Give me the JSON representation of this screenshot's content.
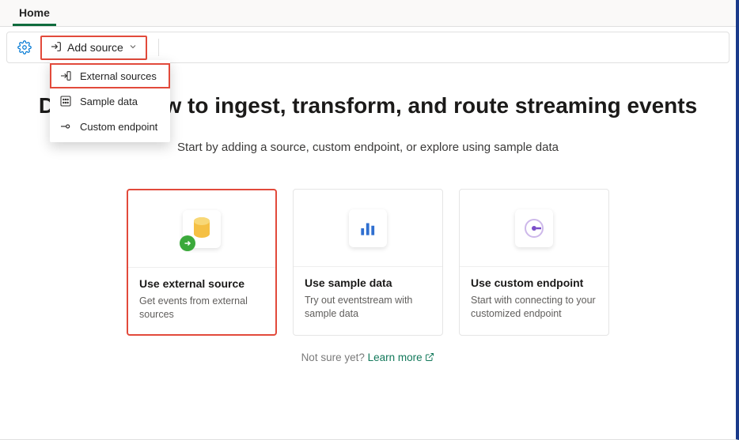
{
  "tabs": {
    "home": "Home"
  },
  "toolbar": {
    "add_source": "Add source"
  },
  "menu": {
    "external": "External sources",
    "sample": "Sample data",
    "custom": "Custom endpoint"
  },
  "main": {
    "heading": "Design a flow to ingest, transform, and route streaming events",
    "subheading": "Start by adding a source, custom endpoint, or explore using sample data"
  },
  "cards": {
    "external": {
      "title": "Use external source",
      "desc": "Get events from external sources"
    },
    "sample": {
      "title": "Use sample data",
      "desc": "Try out eventstream with sample data"
    },
    "custom": {
      "title": "Use custom endpoint",
      "desc": "Start with connecting to your customized endpoint"
    }
  },
  "footer": {
    "prompt": "Not sure yet? ",
    "learn": "Learn more"
  },
  "colors": {
    "highlight": "#e24a3b",
    "primary_green": "#0f6c3d",
    "link_green": "#13795b",
    "blue": "#0078d4",
    "endpoint_purple": "#7b4fc9",
    "bar_blue": "#2f6fd0",
    "db_yellow": "#f5c044"
  }
}
